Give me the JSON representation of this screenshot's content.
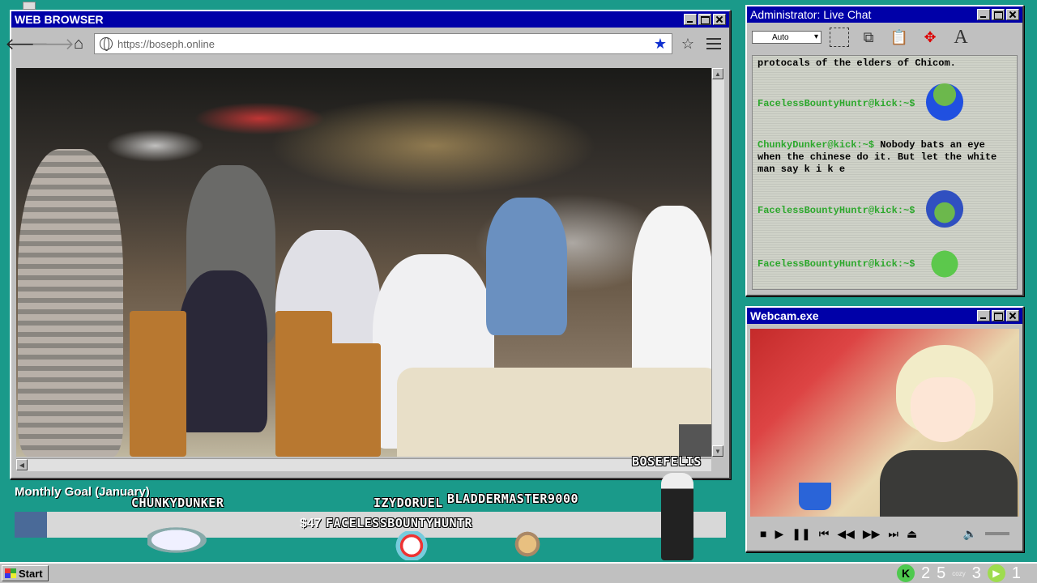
{
  "browser": {
    "title": "WEB BROWSER",
    "url": "https://boseph.online",
    "streamer_tag": "BOSEFELIS"
  },
  "chat": {
    "title": "Administrator: Live Chat",
    "font_select": "Auto",
    "messages": [
      {
        "user": "",
        "text": "protocals of the elders of Chicom."
      },
      {
        "user": "FacelessBountyHuntr@kick:~$",
        "text": "",
        "emote": "blue-frog-emote"
      },
      {
        "user": "ChunkyDunker@kick:~$",
        "text": "Nobody bats an eye when the chinese do it. But let the white man say k i k e"
      },
      {
        "user": "FacelessBountyHuntr@kick:~$",
        "text": "",
        "emote": "wizard-frog-emote"
      },
      {
        "user": "FacelessBountyHuntr@kick:~$",
        "text": "",
        "emote": "pepe-emote"
      }
    ]
  },
  "webcam": {
    "title": "Webcam.exe"
  },
  "goal": {
    "title": "Monthly Goal (January)",
    "amount": "$47",
    "progress": 0.045
  },
  "overlay_names": {
    "chunkydunker": "CHUNKYDUNKER",
    "izydoruel": "IZYDORUEL",
    "bladdermaster": "BLADDERMASTER9000",
    "facelessbountyhuntr": "FACELESSBOUNTYHUNTR"
  },
  "taskbar": {
    "start_label": "Start",
    "tray_count_1": "2",
    "tray_count_2": "5",
    "tray_cozy": "cozy",
    "tray_count_3": "3",
    "tray_count_4": "1"
  },
  "colors": {
    "desktop": "#1a9a8a",
    "titlebar": "#0000a8",
    "chat_username": "#2ca82c",
    "bookmark_star": "#1030d0",
    "goal_fill": "#4a6a98"
  }
}
